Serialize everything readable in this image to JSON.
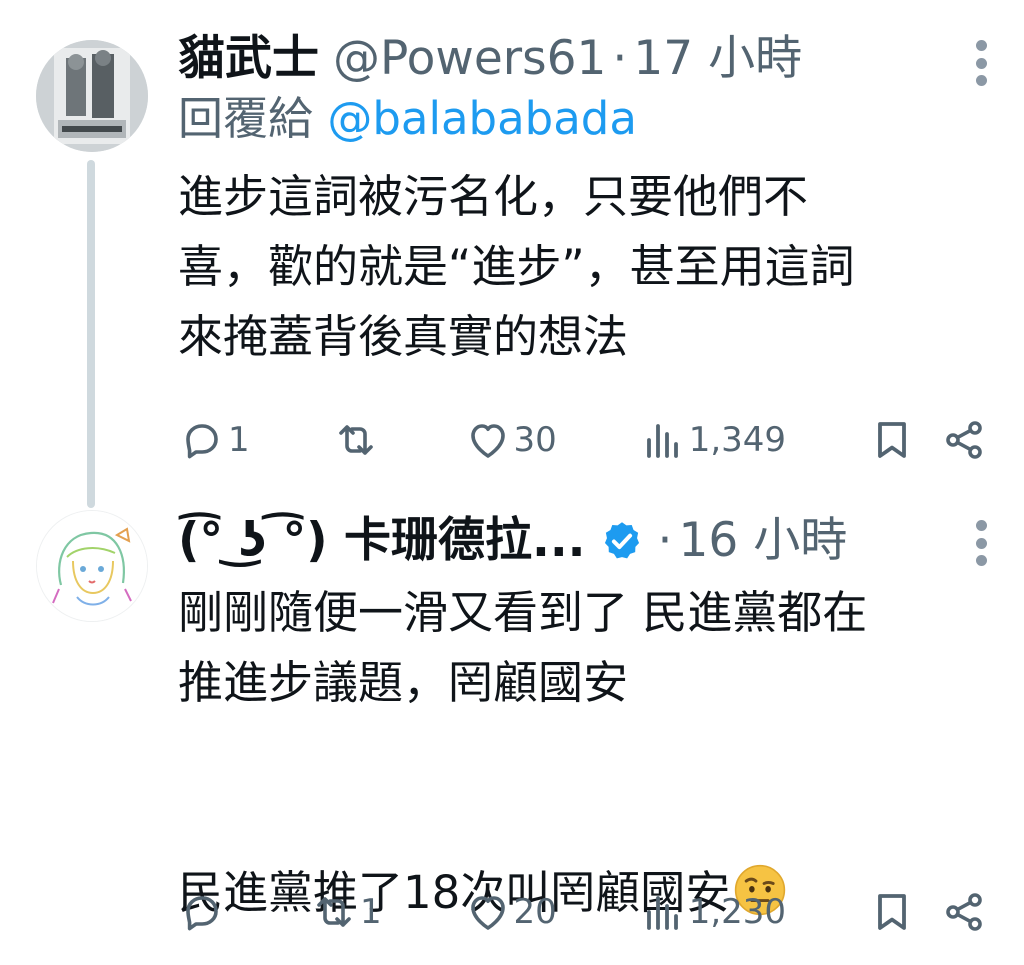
{
  "tweets": [
    {
      "name": "貓武士",
      "handle": "@Powers61",
      "separator": "·",
      "time": "17 小時",
      "reply_prefix": "回覆給 ",
      "reply_mention": "@balababada",
      "text": "進步這詞被污名化，只要他們不\n喜，歡的就是“進步”，甚至用這詞\n來掩蓋背後真實的想法",
      "actions": {
        "replies": "1",
        "reposts": "",
        "likes": "30",
        "views": "1,349"
      },
      "icons": [
        "reply-icon",
        "repost-icon",
        "like-icon",
        "views-icon",
        "bookmark-icon",
        "share-icon"
      ]
    },
    {
      "name": "(͡° ͜ʖ ͡°) 卡珊德拉...",
      "verified": true,
      "separator": "·",
      "time": "16 小時",
      "text": "剛剛隨便一滑又看到了 民進黨都在\n推進步議題，罔顧國安\n\n\n民進黨推了18次叫罔顧國安",
      "emoji": "raised-eyebrow-emoji",
      "actions": {
        "replies": "",
        "reposts": "1",
        "likes": "20",
        "views": "1,230"
      },
      "icons": [
        "reply-icon",
        "repost-icon",
        "like-icon",
        "views-icon",
        "bookmark-icon",
        "share-icon"
      ]
    }
  ],
  "colors": {
    "text": "#0f1419",
    "secondary": "#536471",
    "link": "#1d9bf0",
    "verified": "#1d9bf0",
    "thread_line": "#cfd9de"
  }
}
